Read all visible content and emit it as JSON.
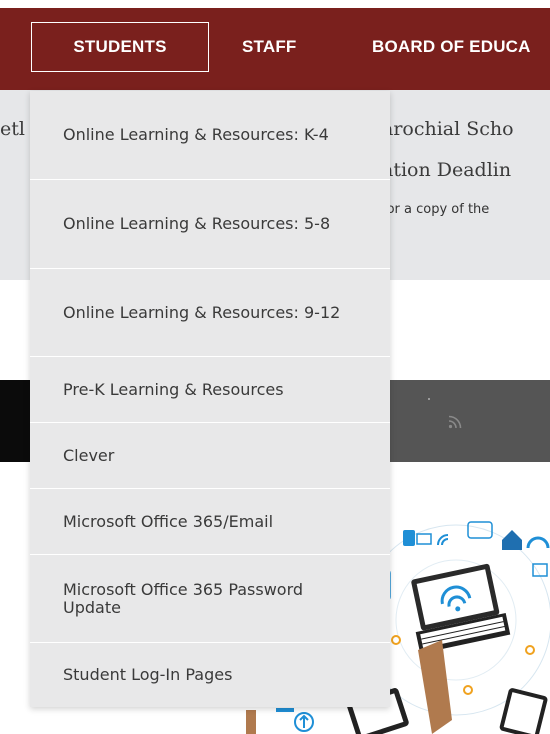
{
  "nav": {
    "items": [
      {
        "label": "STUDENTS"
      },
      {
        "label": "STAFF"
      },
      {
        "label": "BOARD OF EDUCA"
      }
    ]
  },
  "background": {
    "left_fragment": "etl",
    "headline_line1": "arochial Scho",
    "headline_line2": "ation Deadlin",
    "subtext": "for a copy of the"
  },
  "dropdown": {
    "items": [
      {
        "label": "Online Learning & Resources: K-4"
      },
      {
        "label": "Online Learning & Resources: 5-8"
      },
      {
        "label": "Online Learning & Resources: 9-12"
      },
      {
        "label": "Pre-K Learning & Resources"
      },
      {
        "label": "Clever"
      },
      {
        "label": "Microsoft Office 365/Email"
      },
      {
        "label": "Microsoft Office 365 Password Update"
      },
      {
        "label": "Student Log-In Pages"
      }
    ]
  },
  "icons": {
    "rss": "rss-icon"
  },
  "colors": {
    "brand_red": "#7a201d",
    "menu_bg": "#e8e8e9",
    "band_bg": "#e6e7e9",
    "dark_band": "#555555"
  }
}
